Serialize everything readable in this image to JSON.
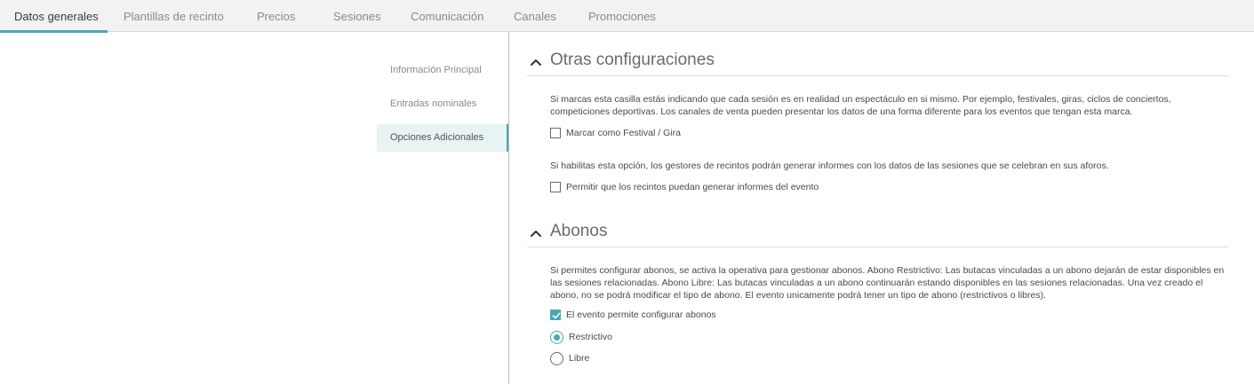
{
  "tabs": [
    {
      "label": "Datos generales",
      "active": true
    },
    {
      "label": "Plantillas de recinto"
    },
    {
      "label": "Precios"
    },
    {
      "label": "Sesiones"
    },
    {
      "label": "Comunicación"
    },
    {
      "label": "Canales"
    },
    {
      "label": "Promociones"
    }
  ],
  "sidenav": {
    "items": [
      {
        "label": "Información Principal"
      },
      {
        "label": "Entradas nominales"
      },
      {
        "label": "Opciones Adicionales",
        "active": true
      }
    ]
  },
  "otras": {
    "title": "Otras configuraciones",
    "festival_desc": "Si marcas esta casilla estás indicando que cada sesión es en realidad un espectáculo en si mismo. Por ejemplo, festivales, giras, ciclos de conciertos, competiciones deportivas. Los canales de venta pueden presentar los datos de una forma diferente para los eventos que tengan esta marca.",
    "festival_label": "Marcar como Festival / Gira",
    "festival_checked": false,
    "reports_desc": "Si habilitas esta opción, los gestores de recintos podrán generar informes con los datos de las sesiones que se celebran en sus aforos.",
    "reports_label": "Permitir que los recintos puedan generar informes del evento",
    "reports_checked": false
  },
  "abonos": {
    "title": "Abonos",
    "desc": "Si permites configurar abonos, se activa la operativa para gestionar abonos. Abono Restrictivo: Las butacas vinculadas a un abono dejarán de estar disponibles en las sesiones relacionadas. Abono Libre: Las butacas vinculadas a un abono continuarán estando disponibles en las sesiones relacionadas. Una vez creado el abono, no se podrá modificar el tipo de abono. El evento unicamente podrá tener un tipo de abono (restrictivos o libres).",
    "enable_label": "El evento permite configurar abonos",
    "enable_checked": true,
    "options": [
      {
        "label": "Restrictivo",
        "selected": true
      },
      {
        "label": "Libre",
        "selected": false
      }
    ]
  },
  "colors": {
    "accent": "#4aa8b3",
    "tabbar_bg": "#f2f2f2",
    "nav_active_bg": "#e8f3f4"
  },
  "icons": {
    "section_toggle": "chevron-up-icon",
    "check": "check-icon"
  }
}
